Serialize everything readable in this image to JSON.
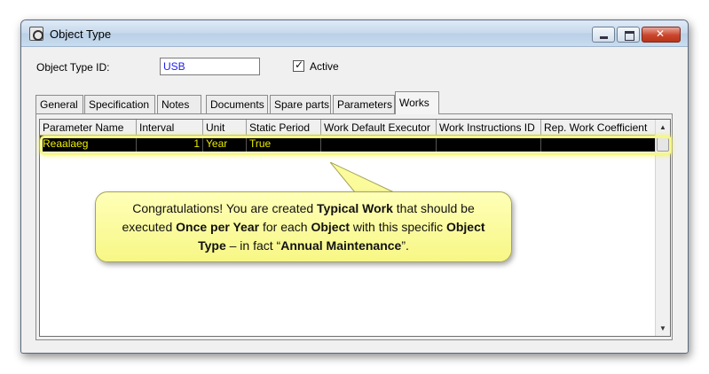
{
  "window": {
    "title": "Object Type",
    "icon": "object-type-icon"
  },
  "form": {
    "id_label": "Object Type ID:",
    "id_value": "USB",
    "active_label": "Active",
    "active_checked": true
  },
  "tabs": [
    {
      "label": "General",
      "active": false
    },
    {
      "label": "Specification",
      "active": false
    },
    {
      "label": "Notes",
      "active": false
    },
    {
      "label": "Documents",
      "active": false
    },
    {
      "label": "Spare parts",
      "active": false
    },
    {
      "label": "Parameters",
      "active": false
    },
    {
      "label": "Works",
      "active": true
    }
  ],
  "grid": {
    "columns": [
      "Parameter Name",
      "Interval",
      "Unit",
      "Static Period",
      "Work Default Executor",
      "Work Instructions ID",
      "Rep. Work Coefficient"
    ],
    "rows": [
      [
        "Reaalaeg",
        "1",
        "Year",
        "True",
        "",
        "",
        ""
      ]
    ]
  },
  "callout": {
    "p1": "Congratulations!  You are created ",
    "b1": "Typical Work",
    "p2": " that should be executed ",
    "b2": "Once per Year",
    "p3": " for each ",
    "b3": "Object",
    "p4": " with this specific ",
    "b4": "Object Type",
    "p5": " – in fact “",
    "b5": "Annual Maintenance",
    "p6": "”."
  },
  "colors": {
    "selected_row_bg": "#000000",
    "selected_row_text": "#e8e800",
    "highlight": "#f7f78a",
    "callout_bg": "#ffffb8",
    "id_text": "#1c1cf0"
  }
}
